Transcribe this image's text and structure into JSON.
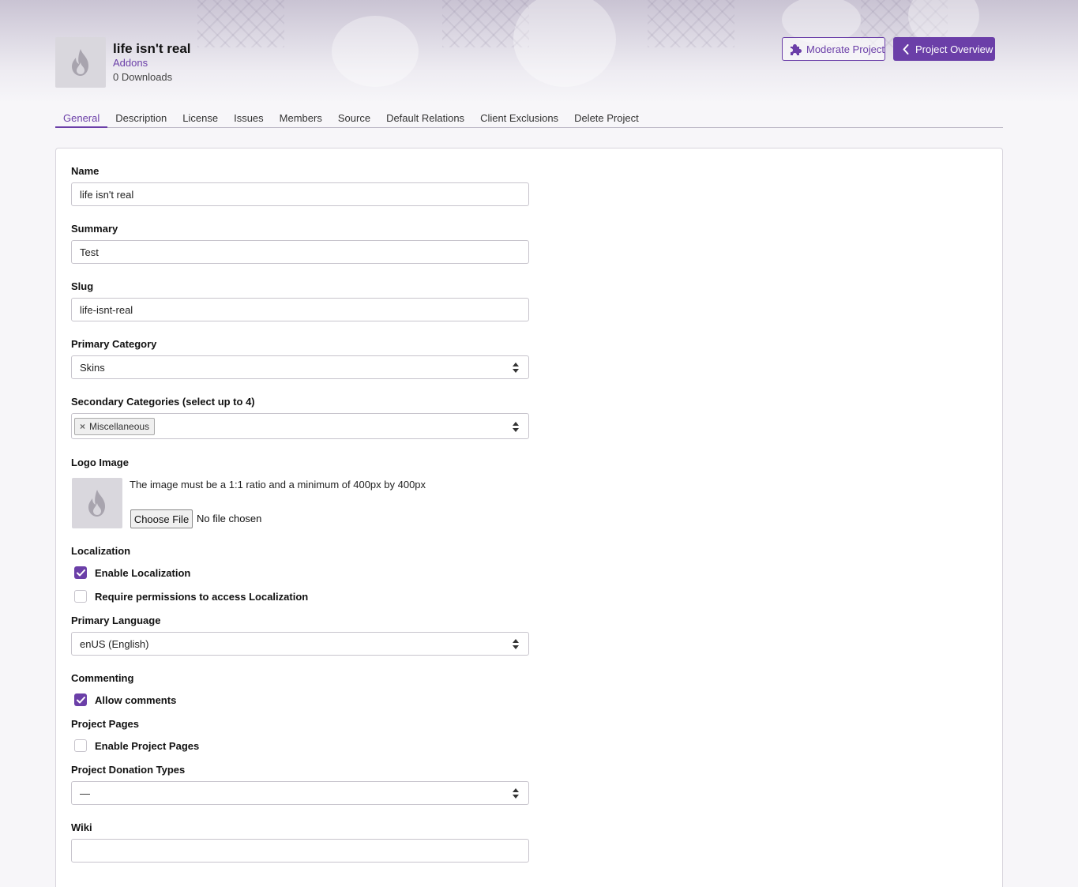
{
  "project": {
    "title": "life isn't real",
    "category": "Addons",
    "downloads": "0 Downloads"
  },
  "header_buttons": {
    "moderate": "Moderate Project",
    "overview": "Project Overview"
  },
  "tabs": [
    {
      "label": "General",
      "active": true
    },
    {
      "label": "Description"
    },
    {
      "label": "License"
    },
    {
      "label": "Issues"
    },
    {
      "label": "Members"
    },
    {
      "label": "Source"
    },
    {
      "label": "Default Relations"
    },
    {
      "label": "Client Exclusions"
    },
    {
      "label": "Delete Project"
    }
  ],
  "form": {
    "name": {
      "label": "Name",
      "value": "life isn't real"
    },
    "summary": {
      "label": "Summary",
      "value": "Test"
    },
    "slug": {
      "label": "Slug",
      "value": "life-isnt-real"
    },
    "primary_category": {
      "label": "Primary Category",
      "value": "Skins"
    },
    "secondary_categories": {
      "label": "Secondary Categories (select up to 4)",
      "tags": [
        "Miscellaneous"
      ],
      "remove_glyph": "×"
    },
    "logo": {
      "label": "Logo Image",
      "note": "The image must be a 1:1 ratio and a minimum of 400px by 400px",
      "button": "Choose File",
      "status": "No file chosen"
    },
    "localization": {
      "label": "Localization",
      "enable": {
        "label": "Enable Localization",
        "checked": true
      },
      "require_permissions": {
        "label": "Require permissions to access Localization",
        "checked": false
      }
    },
    "primary_language": {
      "label": "Primary Language",
      "value": "enUS (English)"
    },
    "commenting": {
      "label": "Commenting",
      "allow": {
        "label": "Allow comments",
        "checked": true
      }
    },
    "project_pages": {
      "label": "Project Pages",
      "enable": {
        "label": "Enable Project Pages",
        "checked": false
      }
    },
    "donation_types": {
      "label": "Project Donation Types",
      "value": "—"
    },
    "wiki": {
      "label": "Wiki",
      "value": ""
    }
  },
  "colors": {
    "accent": "#6b3fa8"
  },
  "icons": {
    "project_icon": "flame-icon",
    "moderate_icon": "puzzle-icon",
    "overview_icon": "chevron-left-icon",
    "select_icon": "sort-arrows-icon",
    "check_icon": "check-icon"
  }
}
